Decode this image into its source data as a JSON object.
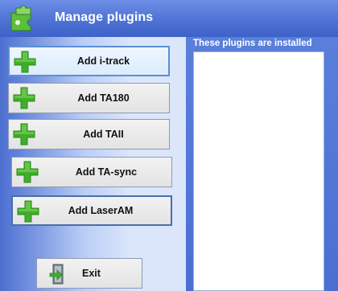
{
  "window": {
    "title": "Manage plugins",
    "icon": "puzzle-piece-icon"
  },
  "installed": {
    "label": "These plugins are installed",
    "items": []
  },
  "buttons": [
    {
      "label": "Add i-track",
      "icon": "plus-icon"
    },
    {
      "label": "Add TA180",
      "icon": "plus-icon"
    },
    {
      "label": "Add TAII",
      "icon": "plus-icon"
    },
    {
      "label": "Add TA-sync",
      "icon": "plus-icon"
    },
    {
      "label": "Add LaserAM",
      "icon": "plus-icon"
    }
  ],
  "exit": {
    "label": "Exit",
    "icon": "exit-door-icon"
  },
  "colors": {
    "titlebar": "#4f73d4",
    "panel": "#3f63c6",
    "plus": "#3fae2a",
    "focus_border": "#5c8fd6"
  }
}
